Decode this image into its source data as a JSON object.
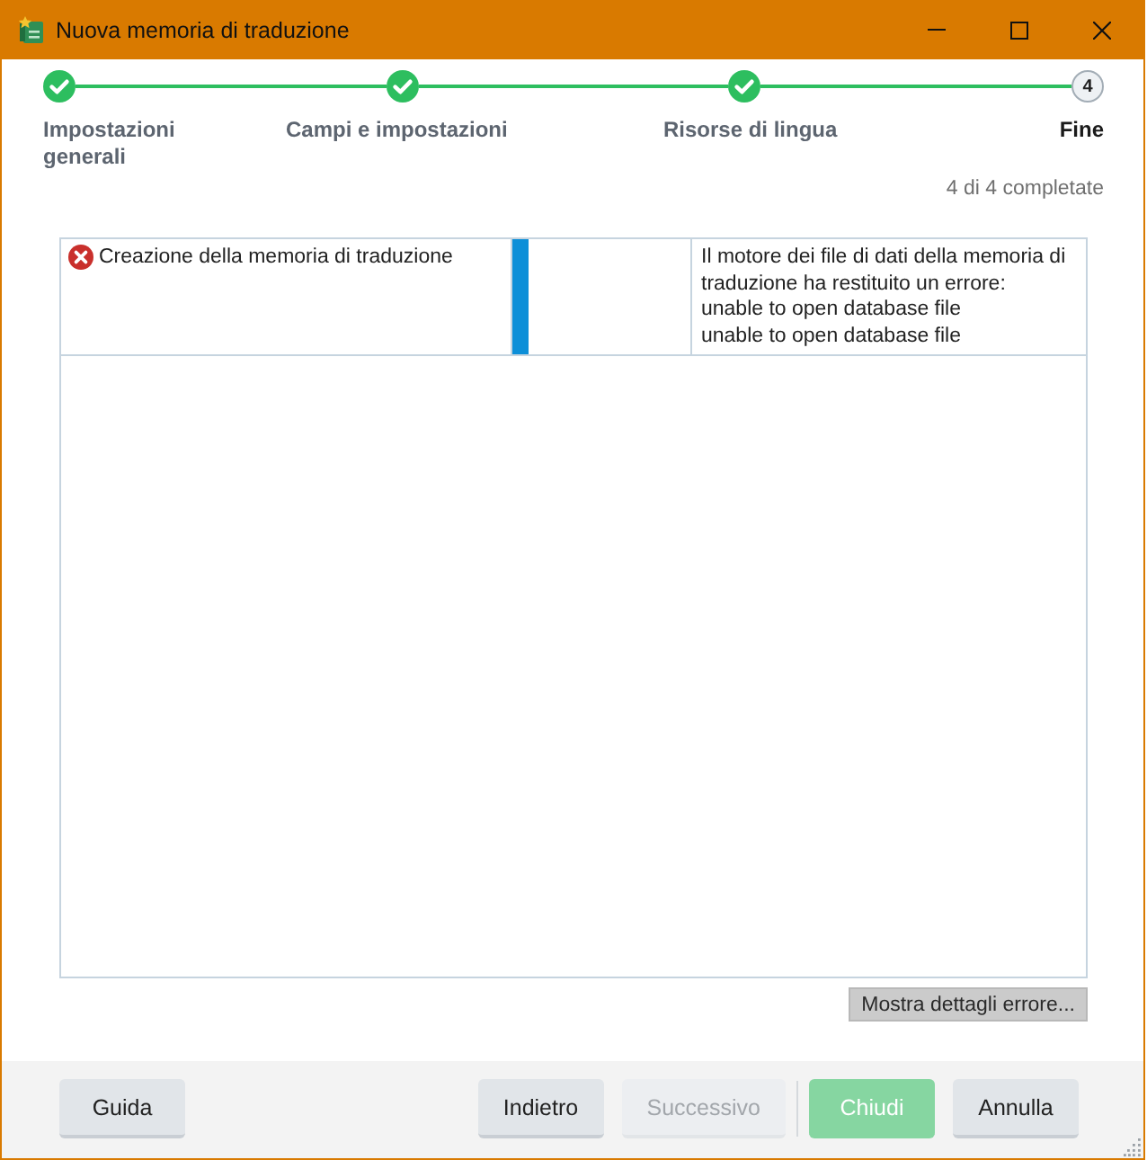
{
  "window": {
    "title": "Nuova memoria di traduzione"
  },
  "steps": [
    {
      "label": "Impostazioni generali",
      "completed": true,
      "selected": false
    },
    {
      "label": "Campi e impostazioni",
      "completed": true,
      "selected": false
    },
    {
      "label": "Risorse di lingua",
      "completed": true,
      "selected": false
    },
    {
      "label": "Fine",
      "number": "4",
      "completed": false,
      "selected": true
    }
  ],
  "progress_summary": "4 di 4 completate",
  "tasks": [
    {
      "name": "Creazione della memoria di traduzione",
      "kind": "error",
      "message": "Il motore dei file di dati della memoria di traduzione ha restituito un errore:\nunable to open database file\nunable to open database file"
    }
  ],
  "details_button": {
    "label": "Mostra dettagli errore..."
  },
  "footer": {
    "help_button": {
      "label": "Guida",
      "kind": "default",
      "disabled": false
    },
    "nav_buttons": [
      {
        "label": "Indietro",
        "kind": "default",
        "disabled": false
      },
      {
        "label": "Successivo",
        "kind": "default",
        "disabled": true
      }
    ],
    "action_buttons": [
      {
        "label": "Chiudi",
        "kind": "primary",
        "disabled": false
      },
      {
        "label": "Annulla",
        "kind": "default",
        "disabled": false
      }
    ]
  }
}
